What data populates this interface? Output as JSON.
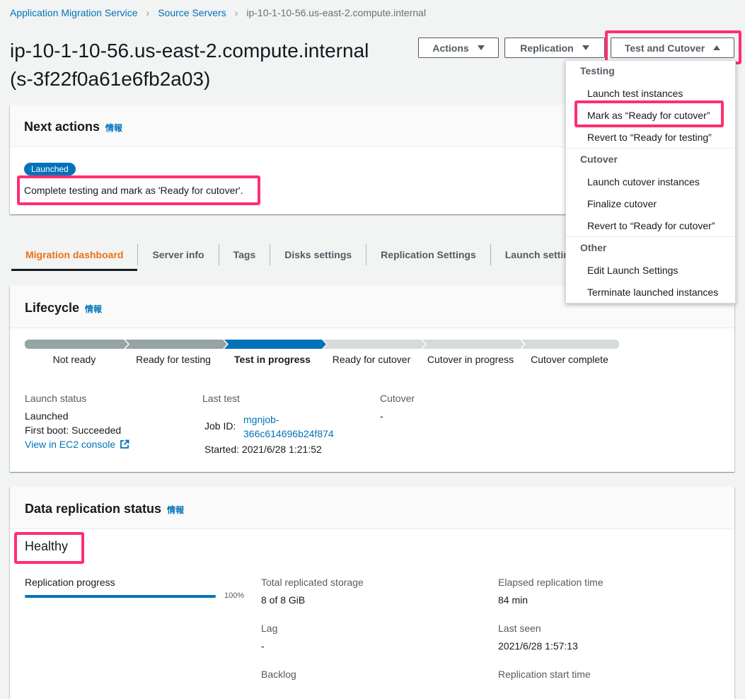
{
  "breadcrumb": {
    "items": [
      "Application Migration Service",
      "Source Servers"
    ],
    "current": "ip-10-1-10-56.us-east-2.compute.internal"
  },
  "page": {
    "title_line1": "ip-10-1-10-56.us-east-2.compute.internal",
    "title_line2": "(s-3f22f0a61e6fb2a03)"
  },
  "header_buttons": {
    "actions": "Actions",
    "replication": "Replication",
    "test_cutover": "Test and Cutover"
  },
  "dropdown": {
    "groups": [
      {
        "label": "Testing",
        "items": [
          "Launch test instances",
          "Mark as “Ready for cutover”",
          "Revert to “Ready for testing”"
        ]
      },
      {
        "label": "Cutover",
        "items": [
          "Launch cutover instances",
          "Finalize cutover",
          "Revert to “Ready for cutover”"
        ]
      },
      {
        "label": "Other",
        "items": [
          "Edit Launch Settings",
          "Terminate launched instances"
        ]
      }
    ]
  },
  "next_actions": {
    "title": "Next actions",
    "info": "情報",
    "badge": "Launched",
    "message": "Complete testing and mark as 'Ready for cutover'."
  },
  "tabs": [
    "Migration dashboard",
    "Server info",
    "Tags",
    "Disks settings",
    "Replication Settings",
    "Launch settin"
  ],
  "lifecycle": {
    "title": "Lifecycle",
    "info": "情報",
    "steps": [
      "Not ready",
      "Ready for testing",
      "Test in progress",
      "Ready for cutover",
      "Cutover in progress",
      "Cutover complete"
    ],
    "active_step": 2,
    "launch_status": {
      "label": "Launch status",
      "value": "Launched",
      "first_boot": "First boot: Succeeded",
      "ec2_link": "View in EC2 console"
    },
    "last_test": {
      "label": "Last test",
      "job_id_label": "Job ID:",
      "job_id_line1": "mgnjob-",
      "job_id_line2": "366c614696b24f874",
      "started": "Started: 2021/6/28 1:21:52"
    },
    "cutover": {
      "label": "Cutover",
      "value": "-"
    }
  },
  "replication": {
    "title": "Data replication status",
    "info": "情報",
    "health": "Healthy",
    "progress_label": "Replication progress",
    "progress_percent": "100%",
    "progress_fraction": 1.0,
    "total_storage_label": "Total replicated storage",
    "total_storage": "8 of 8 GiB",
    "lag_label": "Lag",
    "lag": "-",
    "backlog_label": "Backlog",
    "elapsed_label": "Elapsed replication time",
    "elapsed": "84 min",
    "last_seen_label": "Last seen",
    "last_seen": "2021/6/28 1:57:13",
    "start_time_label": "Replication start time"
  },
  "colors": {
    "accent": "#0073bb",
    "highlight": "#ff2f6e",
    "active_tab": "#ec7211",
    "step_done": "#95a5a6",
    "step_active": "#0073bb",
    "step_pending": "#d5dbdb"
  }
}
